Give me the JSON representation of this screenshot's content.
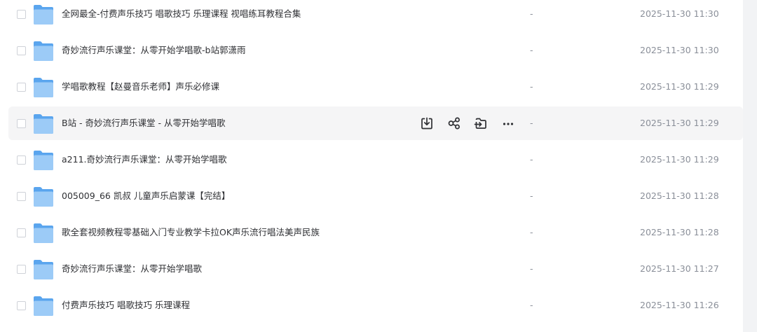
{
  "files": [
    {
      "name": "全网最全-付费声乐技巧 唱歌技巧 乐理课程 视唱练耳教程合集",
      "size": "-",
      "modified": "2025-11-30 11:30"
    },
    {
      "name": "奇妙流行声乐课堂：从零开始学唱歌-b站郭潇雨",
      "size": "-",
      "modified": "2025-11-30 11:30"
    },
    {
      "name": "学唱歌教程【赵曼音乐老师】声乐必修课",
      "size": "-",
      "modified": "2025-11-30 11:29"
    },
    {
      "name": "B站 - 奇妙流行声乐课堂 - 从零开始学唱歌",
      "size": "-",
      "modified": "2025-11-30 11:29"
    },
    {
      "name": "a211.奇妙流行声乐课堂：从零开始学唱歌",
      "size": "-",
      "modified": "2025-11-30 11:29"
    },
    {
      "name": "005009_66 凯叔 儿童声乐启蒙课【完结】",
      "size": "-",
      "modified": "2025-11-30 11:28"
    },
    {
      "name": "歌全套视频教程零基础入门专业教学卡拉OK声乐流行唱法美声民族",
      "size": "-",
      "modified": "2025-11-30 11:28"
    },
    {
      "name": "奇妙流行声乐课堂：从零开始学唱歌",
      "size": "-",
      "modified": "2025-11-30 11:27"
    },
    {
      "name": "付费声乐技巧 唱歌技巧 乐理课程",
      "size": "-",
      "modified": "2025-11-30 11:26"
    }
  ],
  "hovered_row": 3,
  "row_actions": [
    "download-icon",
    "share-icon",
    "move-icon",
    "more-icon"
  ],
  "colors": {
    "folder_back": "#5aa5ee",
    "folder_front": "#9ccbf7",
    "hover_bg": "#f5f5f6",
    "text": "#2f3034",
    "muted": "#8a8f99",
    "icon": "#2f3034"
  }
}
